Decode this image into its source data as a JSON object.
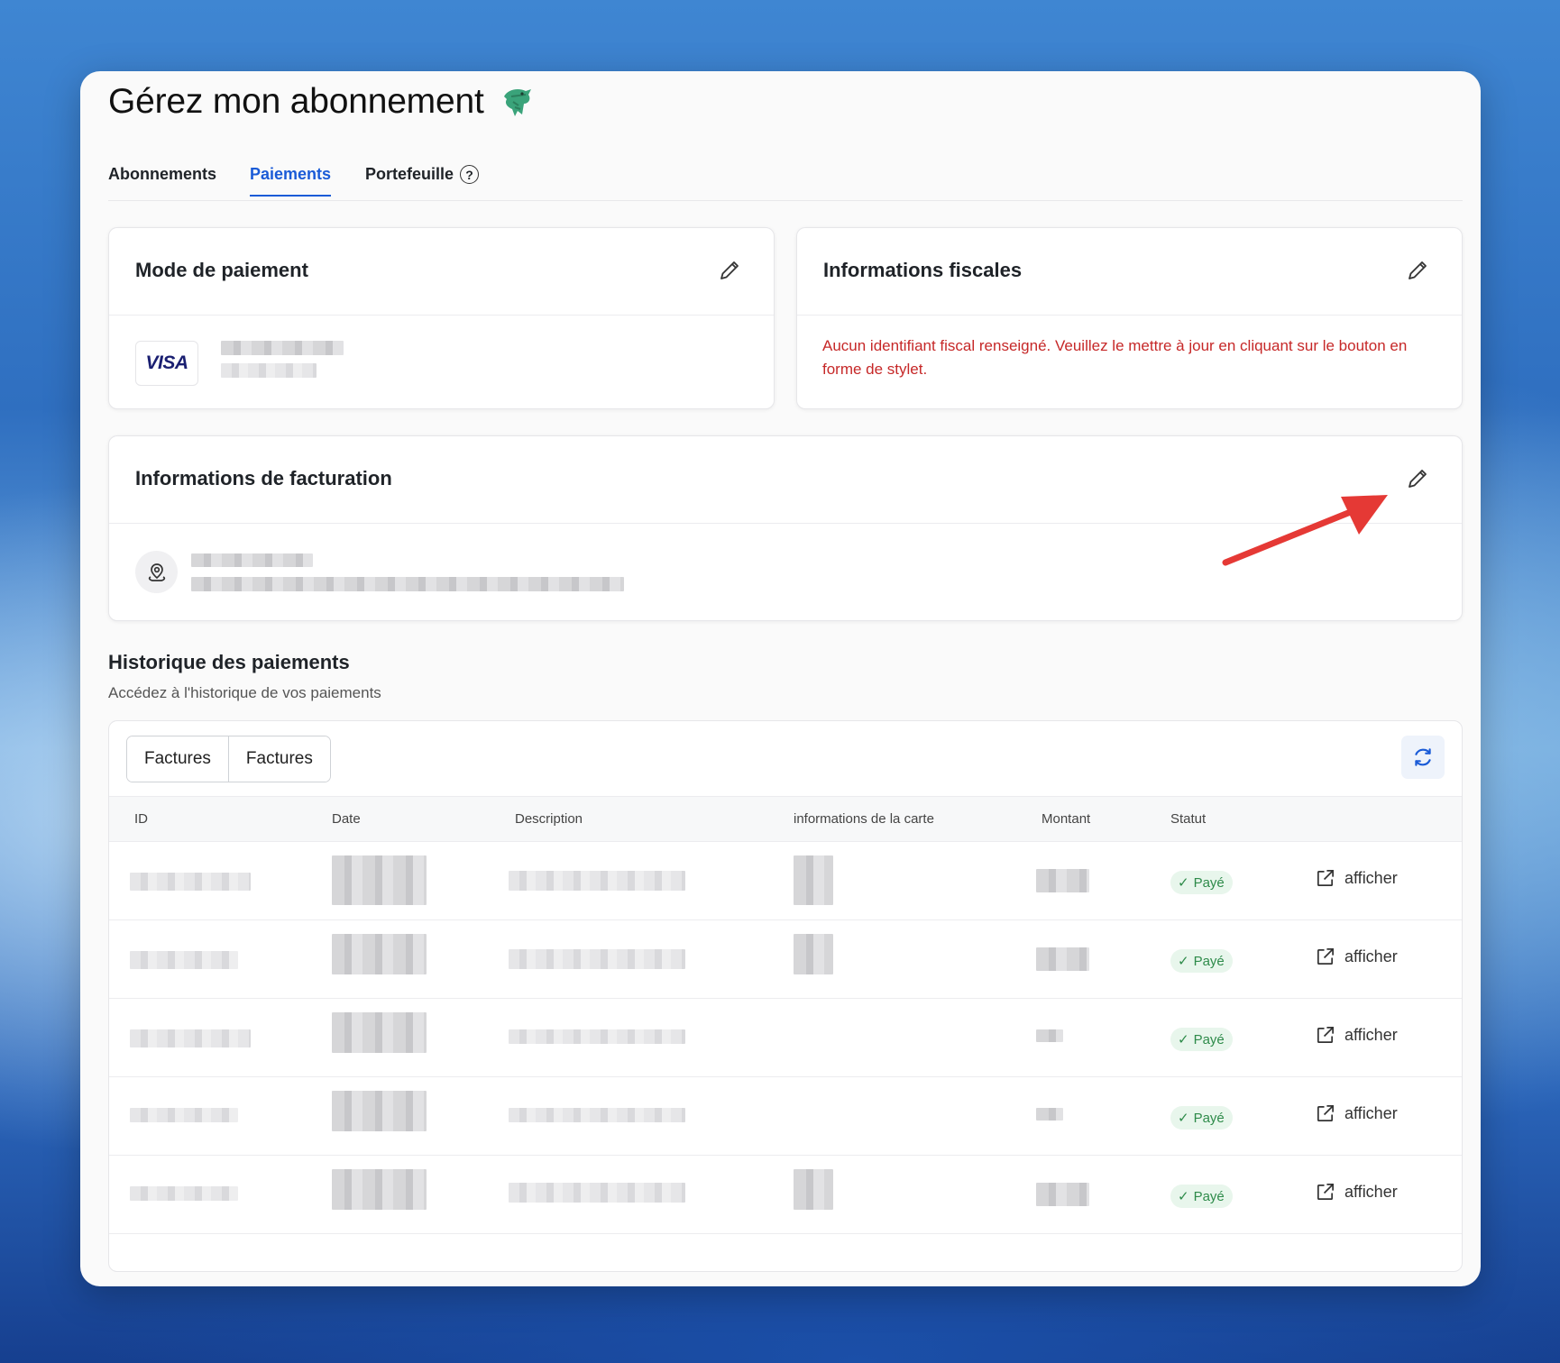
{
  "page": {
    "title": "Gérez mon abonnement"
  },
  "tabs": [
    {
      "label": "Abonnements",
      "active": false
    },
    {
      "label": "Paiements",
      "active": true
    },
    {
      "label": "Portefeuille",
      "active": false,
      "icon": "help-circle-icon"
    }
  ],
  "payment_method": {
    "title": "Mode de paiement",
    "brand": "VISA"
  },
  "tax_info": {
    "title": "Informations fiscales",
    "message": "Aucun identifiant fiscal renseigné. Veuillez le mettre à jour en cliquant sur le bouton en forme de stylet."
  },
  "billing_info": {
    "title": "Informations de facturation"
  },
  "history": {
    "title": "Historique des paiements",
    "subtitle": "Accédez à l'historique de vos paiements",
    "segments": [
      "Factures",
      "Factures"
    ],
    "columns": [
      "ID",
      "Date",
      "Description",
      "informations de la carte",
      "Montant",
      "Statut"
    ],
    "rows": [
      {
        "status": "Payé",
        "action": "afficher"
      },
      {
        "status": "Payé",
        "action": "afficher"
      },
      {
        "status": "Payé",
        "action": "afficher"
      },
      {
        "status": "Payé",
        "action": "afficher"
      },
      {
        "status": "Payé",
        "action": "afficher"
      }
    ]
  },
  "colors": {
    "accent": "#1a5bd7",
    "error": "#c62828",
    "success_text": "#2e8b4a",
    "success_bg": "#e8f6ec",
    "annotation": "#e53935"
  }
}
